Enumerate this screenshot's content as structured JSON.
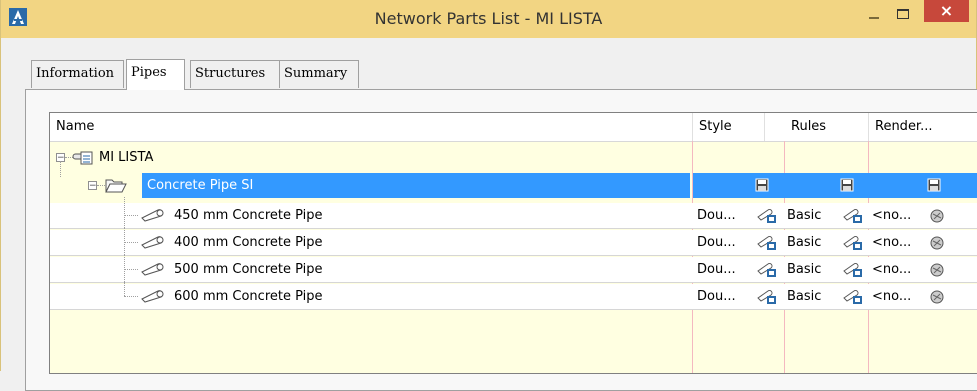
{
  "window": {
    "title": "Network Parts List - MI LISTA",
    "close_glyph": "×"
  },
  "tabs": [
    {
      "label": "Information"
    },
    {
      "label": "Pipes",
      "active": true
    },
    {
      "label": "Structures"
    },
    {
      "label": "Summary"
    }
  ],
  "columns": {
    "name": "Name",
    "style": "Style",
    "rules": "Rules",
    "render": "Render..."
  },
  "tree": {
    "root": {
      "label": "MI LISTA",
      "icon": "network-icon"
    },
    "family": {
      "label": "Concrete Pipe SI",
      "icon": "folder-open-icon",
      "selected": true
    },
    "parts": [
      {
        "name": "450 mm Concrete Pipe",
        "style": "Dou...",
        "rules": "Basic",
        "render": "<no..."
      },
      {
        "name": "400 mm Concrete Pipe",
        "style": "Dou...",
        "rules": "Basic",
        "render": "<no..."
      },
      {
        "name": "500 mm Concrete Pipe",
        "style": "Dou...",
        "rules": "Basic",
        "render": "<no..."
      },
      {
        "name": "600 mm Concrete Pipe",
        "style": "Dou...",
        "rules": "Basic",
        "render": "<no..."
      }
    ]
  },
  "colors": {
    "titlebar": "#f2d583",
    "selection": "#3399ff",
    "grid_background": "#ffffe1",
    "close_button": "#c7483b"
  }
}
